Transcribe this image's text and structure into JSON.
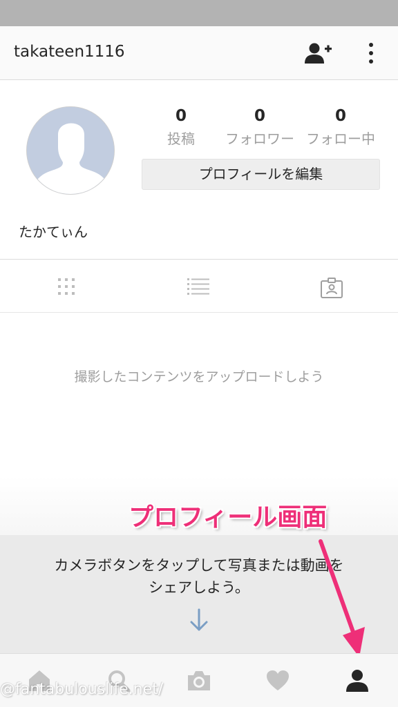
{
  "header": {
    "username": "takateen1116",
    "add_user_icon": "person-add-icon",
    "more_icon": "vertical-dots-icon"
  },
  "profile": {
    "stats": [
      {
        "count": "0",
        "label": "投稿"
      },
      {
        "count": "0",
        "label": "フォロワー"
      },
      {
        "count": "0",
        "label": "フォロー中"
      }
    ],
    "edit_button_label": "プロフィールを編集",
    "display_name": "たかてぃん"
  },
  "tabs": [
    {
      "icon": "grid-icon",
      "active": true
    },
    {
      "icon": "list-icon",
      "active": false
    },
    {
      "icon": "tagged-photos-icon",
      "active": false
    }
  ],
  "empty_state": {
    "message": "撮影したコンテンツをアップロードしよう"
  },
  "tip": {
    "message": "カメラボタンをタップして写真または動画をシェアしよう。",
    "icon": "arrow-down-icon"
  },
  "annotation": {
    "label": "プロフィール画面",
    "color": "#ee2f78"
  },
  "bottom_nav": [
    {
      "icon": "home-icon",
      "active": false
    },
    {
      "icon": "search-icon",
      "active": false
    },
    {
      "icon": "camera-icon",
      "active": false
    },
    {
      "icon": "heart-icon",
      "active": false
    },
    {
      "icon": "profile-icon",
      "active": true
    }
  ],
  "watermark": "@fantabulouslife.net/",
  "colors": {
    "status_bar": "#b3b3b3",
    "header_bg": "#fafafa",
    "avatar_bg": "#c2cde0",
    "muted_text": "#9e9e9e",
    "tip_bg": "#eaeaea",
    "tip_arrow": "#7a9ec4",
    "accent": "#ee2f78"
  }
}
